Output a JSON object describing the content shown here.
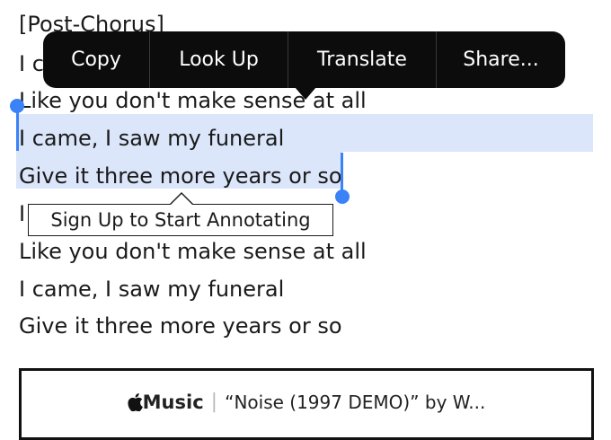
{
  "lyrics": {
    "section": "[Post-Chorus]",
    "line1_partial": "I c",
    "line2": "Like you don't make sense at all",
    "line3": "I came, I saw my funeral",
    "line4": "Give it three more years or so",
    "line5_partial": "I",
    "line6": "Like you don't make sense at all",
    "line7": "I came, I saw my funeral",
    "line8": "Give it three more years or so"
  },
  "context_menu": {
    "items": [
      "Copy",
      "Look Up",
      "Translate",
      "Share..."
    ]
  },
  "annotate_tooltip": {
    "label": "Sign Up to Start Annotating"
  },
  "music_card": {
    "brand": "Music",
    "brand_icon": "apple-icon",
    "separator": "|",
    "track_text": "“Noise (1997 DEMO)” by W..."
  },
  "colors": {
    "selection": "#dbe6fa",
    "handle": "#3b82f6",
    "menu_bg": "#0c0c0c"
  }
}
